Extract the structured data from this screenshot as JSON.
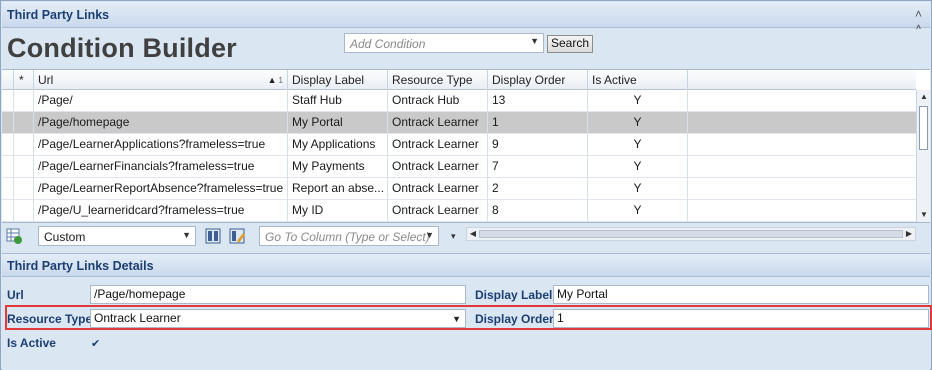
{
  "panel": {
    "title": "Third Party Links",
    "collapse_icon": "double-chevron-up-icon"
  },
  "condition_builder": {
    "title": "Condition Builder",
    "add_condition_placeholder": "Add Condition",
    "search_label": "Search"
  },
  "grid": {
    "columns": [
      "*",
      "Url",
      "Display Label",
      "Resource Type",
      "Display Order",
      "Is Active"
    ],
    "sort": {
      "column": "Url",
      "direction": "ascending",
      "index": "1"
    },
    "rows": [
      {
        "url": "/Page/",
        "label": "Staff Hub",
        "type": "Ontrack Hub",
        "order": "13",
        "active": "Y",
        "selected": false
      },
      {
        "url": "/Page/homepage",
        "label": "My Portal",
        "type": "Ontrack Learner",
        "order": "1",
        "active": "Y",
        "selected": true
      },
      {
        "url": "/Page/LearnerApplications?frameless=true",
        "label": "My Applications",
        "type": "Ontrack Learner",
        "order": "9",
        "active": "Y",
        "selected": false
      },
      {
        "url": "/Page/LearnerFinancials?frameless=true",
        "label": "My Payments",
        "type": "Ontrack Learner",
        "order": "7",
        "active": "Y",
        "selected": false
      },
      {
        "url": "/Page/LearnerReportAbsence?frameless=true",
        "label": "Report an abse...",
        "type": "Ontrack Learner",
        "order": "2",
        "active": "Y",
        "selected": false
      },
      {
        "url": "/Page/U_learneridcard?frameless=true",
        "label": "My ID",
        "type": "Ontrack Learner",
        "order": "8",
        "active": "Y",
        "selected": false
      }
    ]
  },
  "toolbar": {
    "layout_value": "Custom",
    "goto_placeholder": "Go To Column (Type or Select)",
    "icons": [
      "export-grid-icon",
      "layout-save-icon",
      "layout-edit-icon"
    ]
  },
  "details": {
    "title": "Third Party Links Details",
    "url_label": "Url",
    "url_value": "/Page/homepage",
    "display_label_label": "Display Label",
    "display_label_value": "My Portal",
    "resource_type_label": "Resource Type",
    "resource_type_value": "Ontrack Learner",
    "display_order_label": "Display Order",
    "display_order_value": "1",
    "is_active_label": "Is Active",
    "is_active_checked": true
  },
  "colors": {
    "accent": "#1c3e73",
    "highlight": "#e03a3a",
    "selected_row": "#c9c9c9",
    "panel_bg": "#dbe6f3"
  }
}
